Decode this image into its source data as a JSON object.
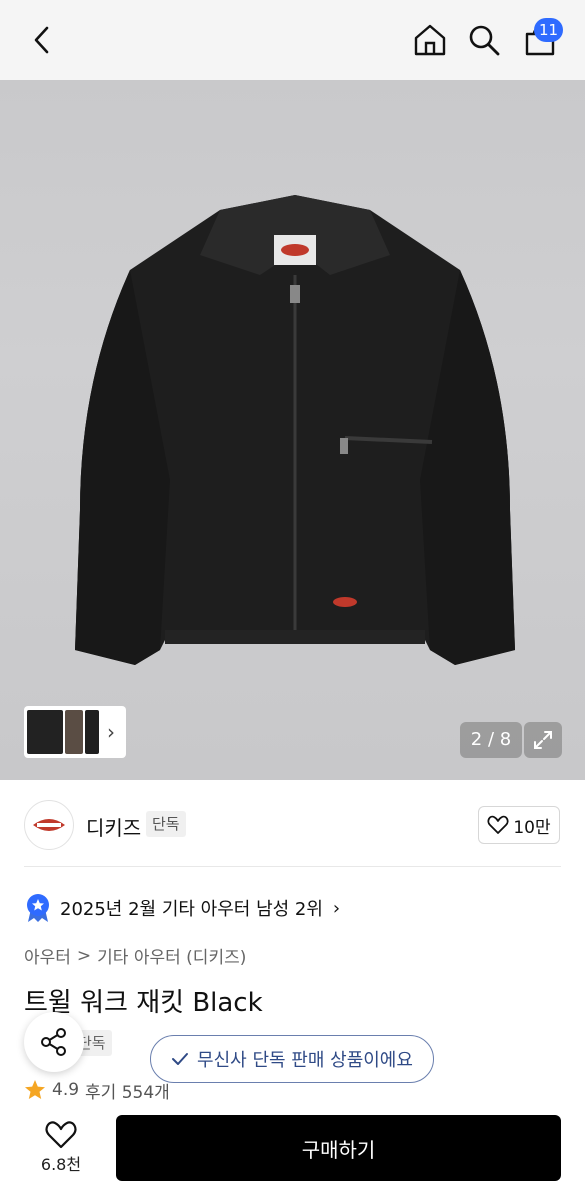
{
  "header": {
    "cart_count": "11"
  },
  "hero": {
    "page_indicator": "2 / 8"
  },
  "brand": {
    "name": "디키즈",
    "tag": "단독",
    "like_count": "10만"
  },
  "ranking": {
    "text": "2025년 2월 기타 아우터 남성 2위",
    "chevron": "›"
  },
  "breadcrumb": {
    "items": [
      "아우터",
      "기타 아우터 (디키즈)"
    ],
    "separator": ">"
  },
  "product": {
    "title": "트윌 워크 재킷 Black",
    "exclusive_tag": "단독",
    "rating": "4.9",
    "review_label": "후기 554개"
  },
  "toast": {
    "text": "무신사 단독 판매 상품이에요"
  },
  "bottom_bar": {
    "like_count": "6.8천",
    "buy_label": "구매하기"
  },
  "colors": {
    "accent_blue": "#2f6bff",
    "toast_text": "#2f4a86",
    "rating_star": "#f5a623",
    "buy_button": "#000000"
  },
  "icons": [
    "back-arrow-icon",
    "home-icon",
    "search-icon",
    "cart-icon",
    "chevron-right-icon",
    "expand-icon",
    "heart-icon",
    "badge-icon",
    "share-icon",
    "check-icon",
    "star-icon"
  ]
}
